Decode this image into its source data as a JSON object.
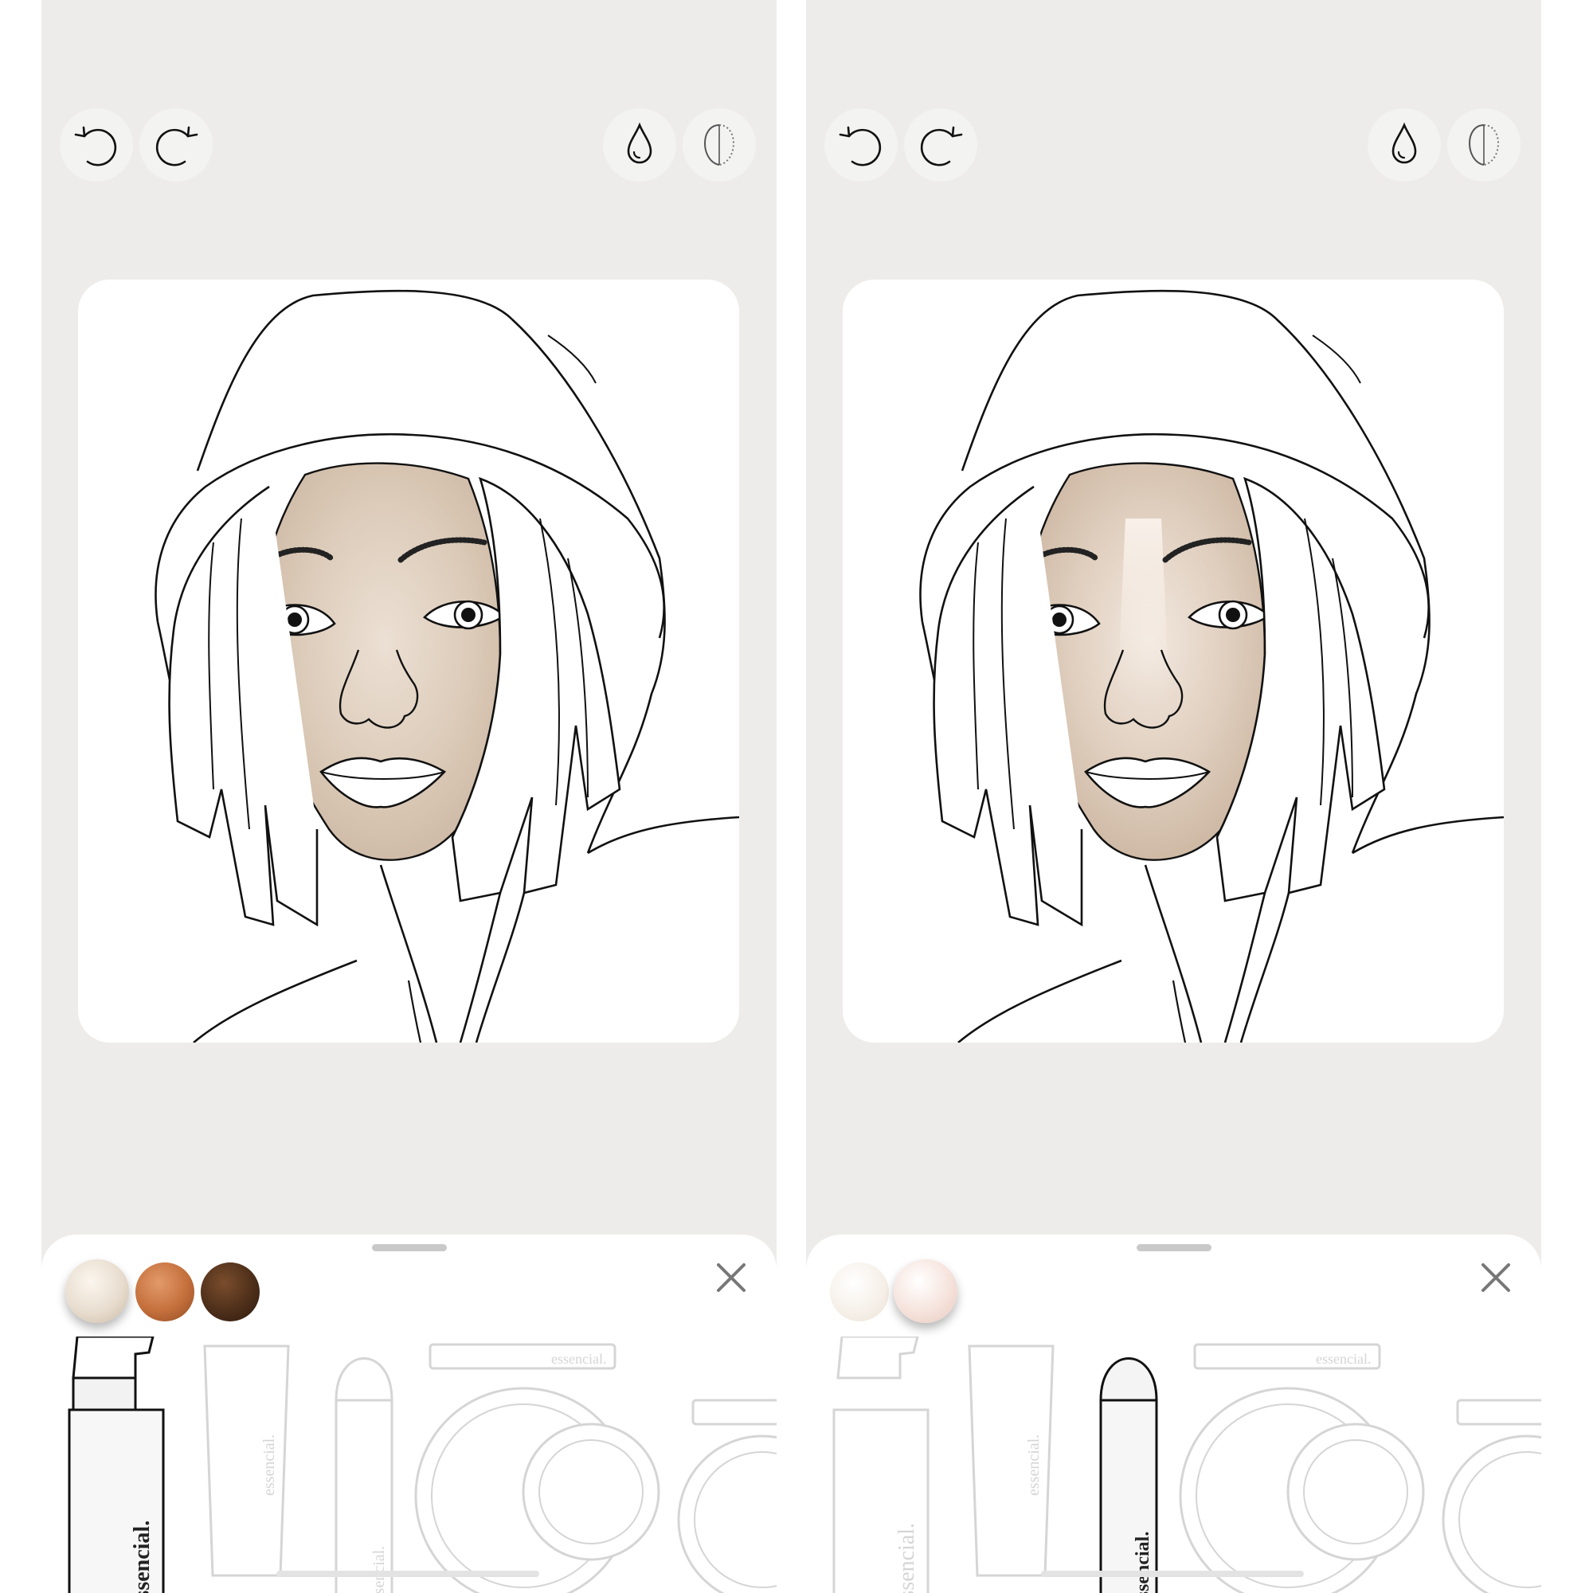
{
  "screens": [
    {
      "id": "left",
      "toolbar": {
        "undo_icon": "undo-arrow-icon",
        "redo_icon": "redo-arrow-icon",
        "drop_icon": "water-drop-icon",
        "face_icon": "face-outline-icon"
      },
      "panel": {
        "close_icon": "close-x-icon",
        "swatches": [
          {
            "color": "#e8ddcf",
            "selected": true
          },
          {
            "color": "#c46f3c",
            "selected": false
          },
          {
            "color": "#4e2f1a",
            "selected": false
          }
        ],
        "products": [
          {
            "type": "foundation-bottle",
            "label": "essencial.",
            "active": true
          },
          {
            "type": "tube",
            "label": "essencial.",
            "active": false
          },
          {
            "type": "stick",
            "label": "essencial.",
            "active": false
          },
          {
            "type": "compact",
            "label": "essencial.",
            "active": false
          },
          {
            "type": "compact-partial",
            "label": "",
            "active": false
          }
        ]
      }
    },
    {
      "id": "right",
      "toolbar": {
        "undo_icon": "undo-arrow-icon",
        "redo_icon": "redo-arrow-icon",
        "drop_icon": "water-drop-icon",
        "face_icon": "face-outline-icon"
      },
      "panel": {
        "close_icon": "close-x-icon",
        "swatches": [
          {
            "color": "#f1e8dd",
            "selected": false
          },
          {
            "color": "#f6e3dc",
            "selected": true
          }
        ],
        "products": [
          {
            "type": "foundation-bottle",
            "label": "essencial.",
            "active": false
          },
          {
            "type": "tube",
            "label": "essencial.",
            "active": false
          },
          {
            "type": "stick",
            "label": "essencial.",
            "active": true
          },
          {
            "type": "compact",
            "label": "essencial.",
            "active": false
          },
          {
            "type": "compact-partial",
            "label": "",
            "active": false
          }
        ]
      }
    }
  ],
  "colors": {
    "background": "#edecea",
    "card": "#ffffff",
    "skin_left": "#e2d2c1",
    "skin_right": "#e5d5c6",
    "line": "#111111"
  }
}
